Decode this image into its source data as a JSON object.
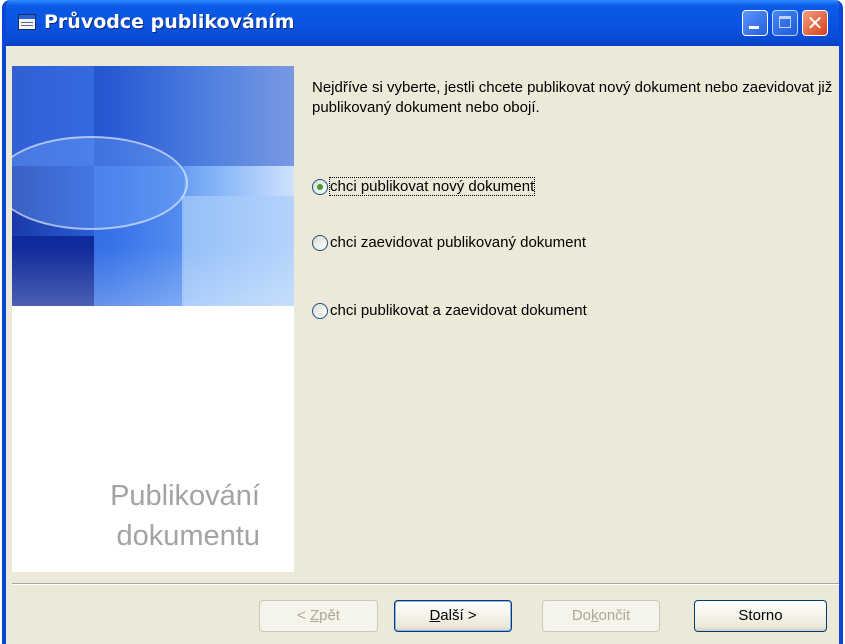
{
  "window": {
    "title": "Průvodce publikováním"
  },
  "side_panel": {
    "caption_line1": "Publikování",
    "caption_line2": "dokumentu"
  },
  "content": {
    "intro_text": "Nejdříve si vyberte, jestli chcete publikovat nový dokument nebo zaevidovat již publikovaný dokument nebo obojí.",
    "options": [
      {
        "label": "chci publikovat nový dokument",
        "selected": true
      },
      {
        "label": "chci zaevidovat publikovaný dokument",
        "selected": false
      },
      {
        "label": "chci publikovat a zaevidovat dokument",
        "selected": false
      }
    ]
  },
  "buttons": {
    "back": {
      "pre": "< ",
      "key": "Z",
      "post": "pět",
      "enabled": false
    },
    "next": {
      "pre": "",
      "key": "D",
      "post": "alší >",
      "enabled": true
    },
    "finish": {
      "pre": "Do",
      "key": "k",
      "post": "ončit",
      "enabled": false
    },
    "cancel": {
      "label": "Storno",
      "enabled": true
    }
  },
  "icons": [
    "app-icon",
    "minimize-icon",
    "maximize-icon",
    "close-icon",
    "radio-icon"
  ]
}
